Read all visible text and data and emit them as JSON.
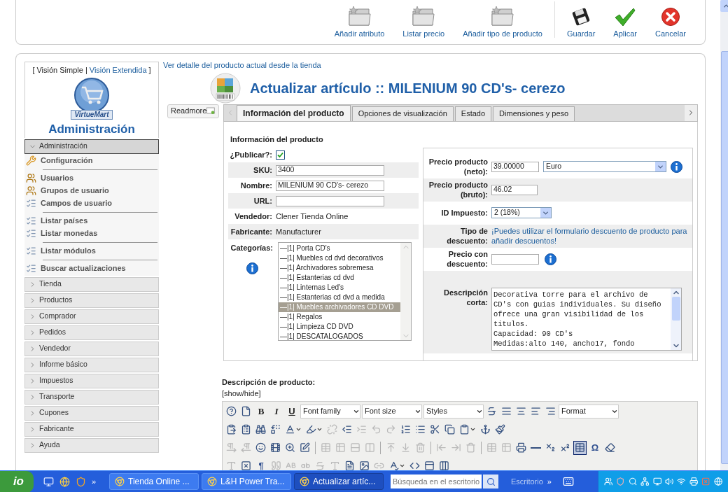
{
  "toolbar": {
    "buttons": [
      {
        "kind": "folder",
        "label": "Añadir atributo"
      },
      {
        "kind": "folder",
        "label": "Listar precio"
      },
      {
        "kind": "folder",
        "label": "Añadir tipo de producto"
      },
      {
        "kind": "save",
        "label": "Guardar"
      },
      {
        "kind": "apply",
        "label": "Aplicar"
      },
      {
        "kind": "cancel",
        "label": "Cancelar"
      }
    ]
  },
  "sidebar": {
    "view_switch": {
      "open": "[",
      "simple": "Visión Simple",
      "separator": "|",
      "extended": "Visión Extendida",
      "close": "]"
    },
    "logo_text": "VirtueMart",
    "heading": "Administración",
    "sections": [
      {
        "label": "Administración",
        "expanded": true,
        "items": [
          {
            "kind": "tools",
            "label": "Configuración"
          },
          {
            "kind": "separator"
          },
          {
            "kind": "users",
            "label": "Usuarios"
          },
          {
            "kind": "users",
            "label": "Grupos de usuario"
          },
          {
            "kind": "list",
            "label": "Campos de usuario"
          },
          {
            "kind": "separator"
          },
          {
            "kind": "list",
            "label": "Listar países"
          },
          {
            "kind": "list",
            "label": "Listar monedas"
          },
          {
            "kind": "separator"
          },
          {
            "kind": "list",
            "label": "Listar módulos"
          },
          {
            "kind": "separator"
          },
          {
            "kind": "list",
            "label": "Buscar actualizaciones"
          }
        ]
      },
      {
        "label": "Tienda",
        "expanded": false
      },
      {
        "label": "Productos",
        "expanded": false
      },
      {
        "label": "Comprador",
        "expanded": false
      },
      {
        "label": "Pedidos",
        "expanded": false
      },
      {
        "label": "Vendedor",
        "expanded": false
      },
      {
        "label": "Informe básico",
        "expanded": false
      },
      {
        "label": "Impuestos",
        "expanded": false
      },
      {
        "label": "Transporte",
        "expanded": false
      },
      {
        "label": "Cupones",
        "expanded": false
      },
      {
        "label": "Fabricante",
        "expanded": false
      },
      {
        "label": "Ayuda",
        "expanded": false
      }
    ]
  },
  "store_link": "Ver detalle del producto actual desde la tienda",
  "title": "Actualizar artículo :: MILENIUM 90 CD's- cerezo",
  "readmore": "Readmore",
  "tabs": [
    {
      "label": "Información del producto",
      "selected": true
    },
    {
      "label": "Opciones de visualización",
      "selected": false
    },
    {
      "label": "Estado",
      "selected": false
    },
    {
      "label": "Dimensiones y peso",
      "selected": false
    }
  ],
  "product_info": {
    "heading": "Información del producto",
    "fields": [
      {
        "kind": "checkbox",
        "label": "¿Publicar?:",
        "checked": true
      },
      {
        "kind": "input",
        "label": "SKU:",
        "value": "3400"
      },
      {
        "kind": "input",
        "label": "Nombre:",
        "value": "MILENIUM 90 CD's- cerezo"
      },
      {
        "kind": "input",
        "label": "URL:"
      },
      {
        "kind": "text",
        "label": "Vendedor:",
        "value": "Clener Tienda Online"
      },
      {
        "kind": "text",
        "label": "Fabricante:",
        "value": "Manufacturer"
      }
    ],
    "categories": {
      "label": "Categorías:",
      "items": [
        {
          "text": "—|1| Porta CD's",
          "selected": false
        },
        {
          "text": "—|1| Muebles cd dvd decorativos",
          "selected": false
        },
        {
          "text": "—|1| Archivadores sobremesa",
          "selected": false
        },
        {
          "text": "—|1| Estanterias cd dvd",
          "selected": false
        },
        {
          "text": "—|1| Linternas Led's",
          "selected": false
        },
        {
          "text": "—|1| Estanterias cd dvd a medida",
          "selected": false
        },
        {
          "text": "—|1| Muebles archivadores CD DVD",
          "selected": true
        },
        {
          "text": "—|1| Regalos",
          "selected": false
        },
        {
          "text": "—|1| Limpieza CD DVD",
          "selected": false
        },
        {
          "text": "—|1| DESCATALOGADOS",
          "selected": false
        }
      ]
    }
  },
  "pricing": {
    "fields": [
      {
        "kind": "price",
        "label": "Precio producto (neto):",
        "value": "39.00000",
        "currency": "Euro"
      },
      {
        "kind": "input",
        "label": "Precio producto (bruto):",
        "value": "46.02"
      },
      {
        "kind": "select",
        "label": "ID Impuesto:",
        "value": "2 (18%)"
      },
      {
        "kind": "link",
        "label": "Tipo de descuento:",
        "value": "¡Puedes utilizar el formulario descuento de producto para añadir descuentos!"
      },
      {
        "kind": "input_info",
        "label": "Precio con descuento:"
      },
      {
        "kind": "textarea",
        "label": "Descripción corta:",
        "value": "Decorativa torre para el archivo de CD's con guias individuales. Su diseño ofrece una gran visibilidad de los titulos.\nCapacidad: 90 CD's\nMedidas:alto 140, ancho17, fondo"
      }
    ]
  },
  "description": {
    "label": "Descripción de producto:",
    "toggle": "[show/hide]"
  },
  "editor": {
    "rows": [
      [
        {
          "kind": "icon",
          "disabled": false,
          "active": false
        },
        {
          "kind": "icon",
          "disabled": false,
          "active": false
        },
        {
          "kind": "bold",
          "text": "B"
        },
        {
          "kind": "italic",
          "text": "I"
        },
        {
          "kind": "underline",
          "text": "U"
        },
        {
          "kind": "select",
          "text": "Font family"
        },
        {
          "kind": "select",
          "text": "Font size"
        },
        {
          "kind": "select",
          "text": "Styles"
        },
        {
          "kind": "icon",
          "disabled": false,
          "active": false
        },
        {
          "kind": "icon",
          "disabled": false,
          "active": false
        },
        {
          "kind": "icon",
          "disabled": false,
          "active": false
        },
        {
          "kind": "icon",
          "disabled": false,
          "active": false
        },
        {
          "kind": "icon",
          "disabled": false,
          "active": false
        },
        {
          "kind": "select",
          "text": "Format"
        }
      ],
      [
        {
          "kind": "icon",
          "disabled": false,
          "active": false
        },
        {
          "kind": "icon",
          "disabled": false,
          "active": false
        },
        {
          "kind": "icon",
          "disabled": false,
          "active": false
        },
        {
          "kind": "icon",
          "disabled": false,
          "active": false
        },
        {
          "kind": "dropdown",
          "disabled": false,
          "active": false
        },
        {
          "kind": "dropdown",
          "disabled": false,
          "active": false
        },
        {
          "kind": "icon",
          "disabled": true,
          "active": false
        },
        {
          "kind": "icon",
          "disabled": false,
          "active": false
        },
        {
          "kind": "icon",
          "disabled": true,
          "active": false
        },
        {
          "kind": "icon",
          "disabled": true,
          "active": false
        },
        {
          "kind": "icon",
          "disabled": true,
          "active": false
        },
        {
          "kind": "icon",
          "disabled": false,
          "active": false
        },
        {
          "kind": "icon",
          "disabled": false,
          "active": false
        },
        {
          "kind": "icon",
          "disabled": false,
          "active": false
        },
        {
          "kind": "icon",
          "disabled": false,
          "active": false
        },
        {
          "kind": "dropdown",
          "disabled": false,
          "active": false
        },
        {
          "kind": "icon",
          "disabled": false,
          "active": false
        },
        {
          "kind": "icon",
          "disabled": false,
          "active": false
        }
      ],
      [
        {
          "kind": "icon",
          "disabled": true,
          "active": false
        },
        {
          "kind": "icon",
          "disabled": true,
          "active": false
        },
        {
          "kind": "icon",
          "disabled": false,
          "active": false
        },
        {
          "kind": "icon",
          "disabled": false,
          "active": false
        },
        {
          "kind": "icon",
          "disabled": false,
          "active": false
        },
        {
          "kind": "icon",
          "disabled": false,
          "active": false
        },
        {
          "kind": "separator"
        },
        {
          "kind": "icon",
          "disabled": true,
          "active": false
        },
        {
          "kind": "icon",
          "disabled": true,
          "active": false
        },
        {
          "kind": "icon",
          "disabled": true,
          "active": false
        },
        {
          "kind": "icon",
          "disabled": true,
          "active": false
        },
        {
          "kind": "separator"
        },
        {
          "kind": "icon",
          "disabled": true,
          "active": false
        },
        {
          "kind": "icon",
          "disabled": true,
          "active": false
        },
        {
          "kind": "icon",
          "disabled": true,
          "active": false
        },
        {
          "kind": "separator"
        },
        {
          "kind": "icon",
          "disabled": true,
          "active": false
        },
        {
          "kind": "icon",
          "disabled": true,
          "active": false
        },
        {
          "kind": "icon",
          "disabled": true,
          "active": false
        },
        {
          "kind": "separator"
        },
        {
          "kind": "icon",
          "disabled": true,
          "active": false
        },
        {
          "kind": "icon",
          "disabled": true,
          "active": false
        },
        {
          "kind": "icon",
          "disabled": false,
          "active": false
        },
        {
          "kind": "icon",
          "disabled": false,
          "active": false
        },
        {
          "kind": "icon",
          "disabled": false,
          "active": false
        },
        {
          "kind": "icon",
          "disabled": false,
          "active": false
        },
        {
          "kind": "icon",
          "disabled": false,
          "active": true
        },
        {
          "kind": "glyph",
          "text": "Ω"
        },
        {
          "kind": "icon",
          "disabled": false,
          "active": false
        }
      ],
      [
        {
          "kind": "icon",
          "disabled": true,
          "active": false
        },
        {
          "kind": "icon",
          "disabled": false,
          "active": false
        },
        {
          "kind": "glyph",
          "text": "¶"
        },
        {
          "kind": "icon",
          "disabled": true,
          "active": false
        },
        {
          "kind": "icon",
          "disabled": true,
          "active": false
        },
        {
          "kind": "icon",
          "disabled": true,
          "active": false
        },
        {
          "kind": "icon",
          "disabled": true,
          "active": false
        },
        {
          "kind": "icon",
          "disabled": true,
          "active": false
        },
        {
          "kind": "icon",
          "disabled": false,
          "active": false
        },
        {
          "kind": "icon",
          "disabled": false,
          "active": false
        },
        {
          "kind": "icon",
          "disabled": true,
          "active": false
        },
        {
          "kind": "dropdown",
          "disabled": false,
          "active": false
        },
        {
          "kind": "icon",
          "disabled": false,
          "active": false
        },
        {
          "kind": "icon",
          "disabled": false,
          "active": false
        },
        {
          "kind": "icon",
          "disabled": false,
          "active": false
        }
      ]
    ]
  },
  "taskbar": {
    "start": "io",
    "tasks": [
      {
        "label": "Tienda Online ...",
        "selected": false
      },
      {
        "label": "L&H Power Tra...",
        "selected": false
      },
      {
        "label": "Actualizar artíc...",
        "selected": true
      }
    ],
    "search_placeholder": "Búsqueda en el escritorio",
    "desktop": "Escritorio",
    "chevron": "»"
  }
}
